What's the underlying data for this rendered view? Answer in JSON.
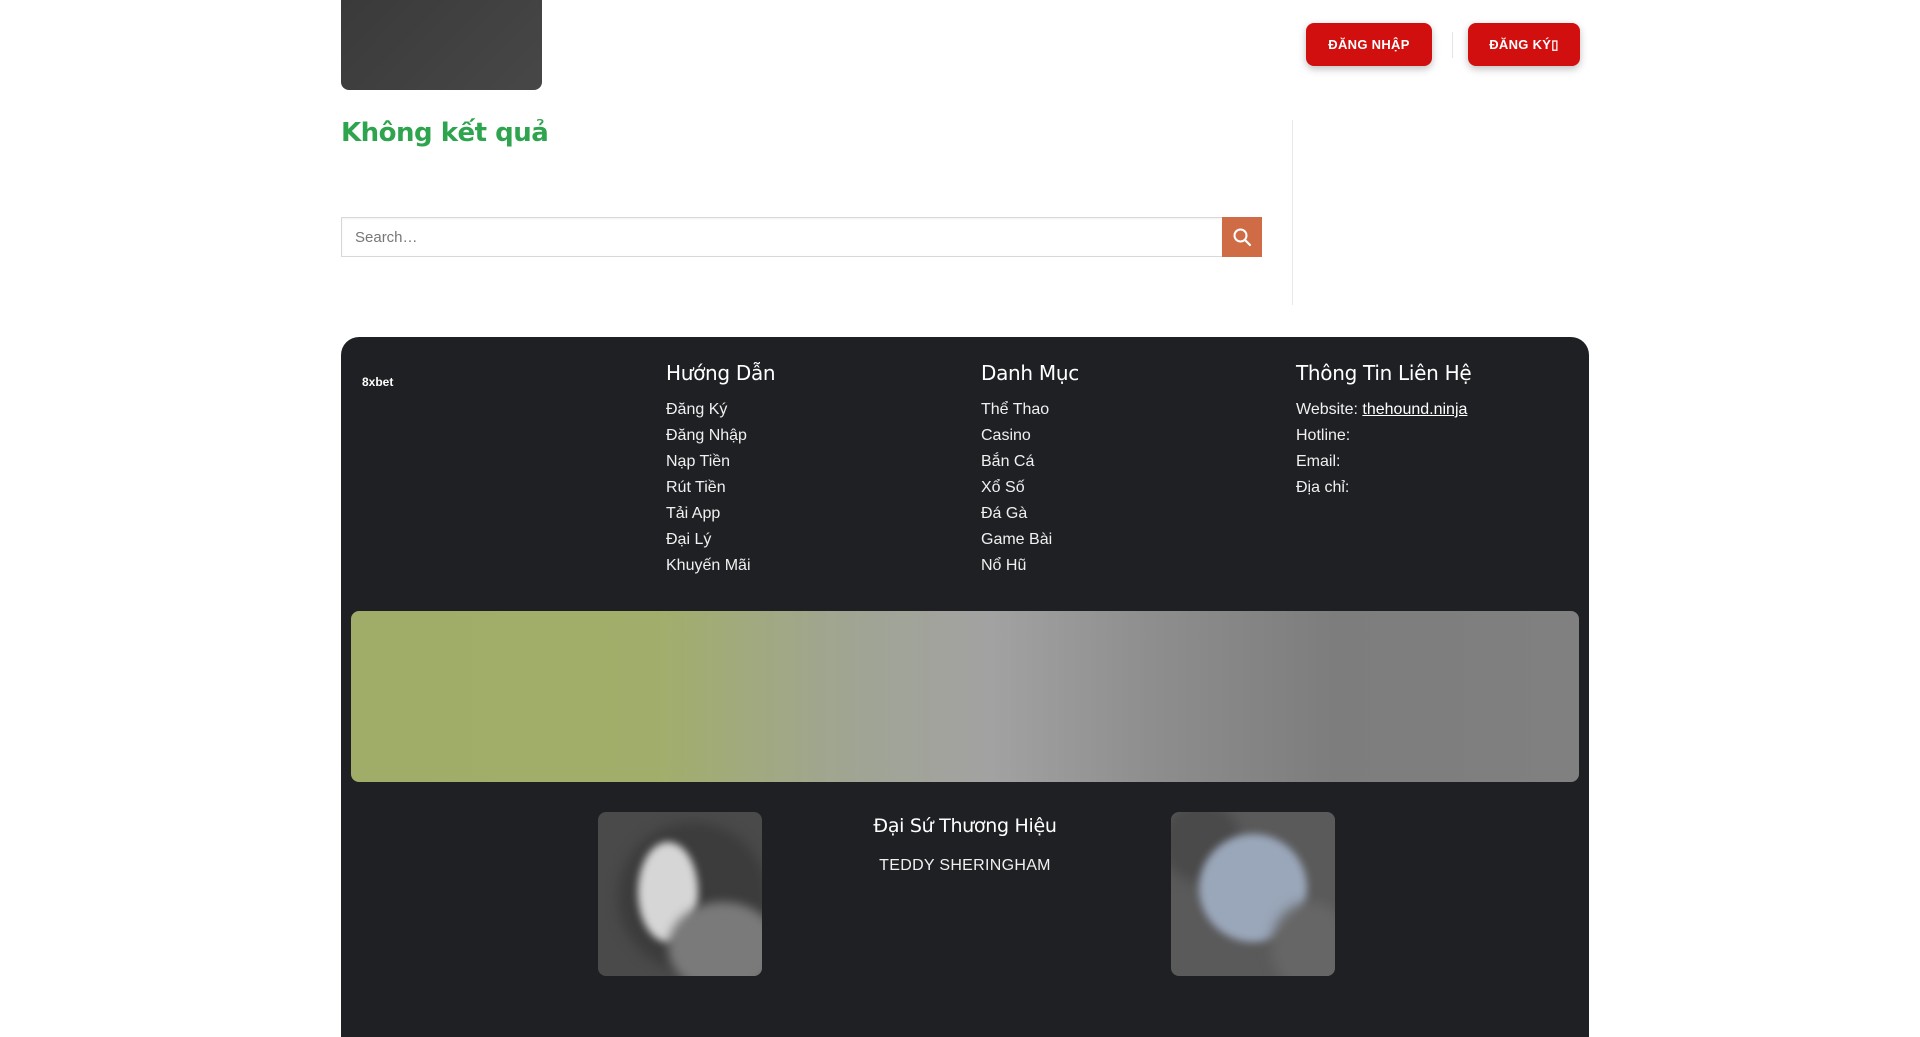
{
  "header": {
    "login_label": "ĐĂNG NHẬP",
    "register_label": "ĐĂNG KÝ▯"
  },
  "main": {
    "title": "Không kết quả",
    "search": {
      "placeholder": "Search…",
      "value": ""
    }
  },
  "footer": {
    "brand": "8xbet",
    "guide": {
      "title": "Hướng Dẫn",
      "items": [
        "Đăng Ký",
        "Đăng Nhập",
        "Nạp Tiền",
        "Rút Tiền",
        "Tải App",
        "Đại Lý",
        "Khuyến Mãi"
      ]
    },
    "category": {
      "title": "Danh Mục",
      "items": [
        "Thể Thao",
        "Casino",
        "Bắn Cá",
        "Xổ Số",
        "Đá Gà",
        "Game Bài",
        "Nổ Hũ"
      ]
    },
    "contact": {
      "title": "Thông Tin Liên Hệ",
      "website_label": "Website:",
      "website_value": "thehound.ninja",
      "hotline_label": "Hotline:",
      "email_label": "Email:",
      "address_label": "Địa chỉ:"
    },
    "ambassador": {
      "title": "Đại Sứ Thương Hiệu",
      "name": "TEDDY SHERINGHAM"
    }
  },
  "colors": {
    "button_red": "#d10f0f",
    "title_green": "#2ea44f",
    "search_button": "#cf6b45",
    "footer_bg": "#1f2023"
  },
  "icons": [
    "search-icon"
  ]
}
